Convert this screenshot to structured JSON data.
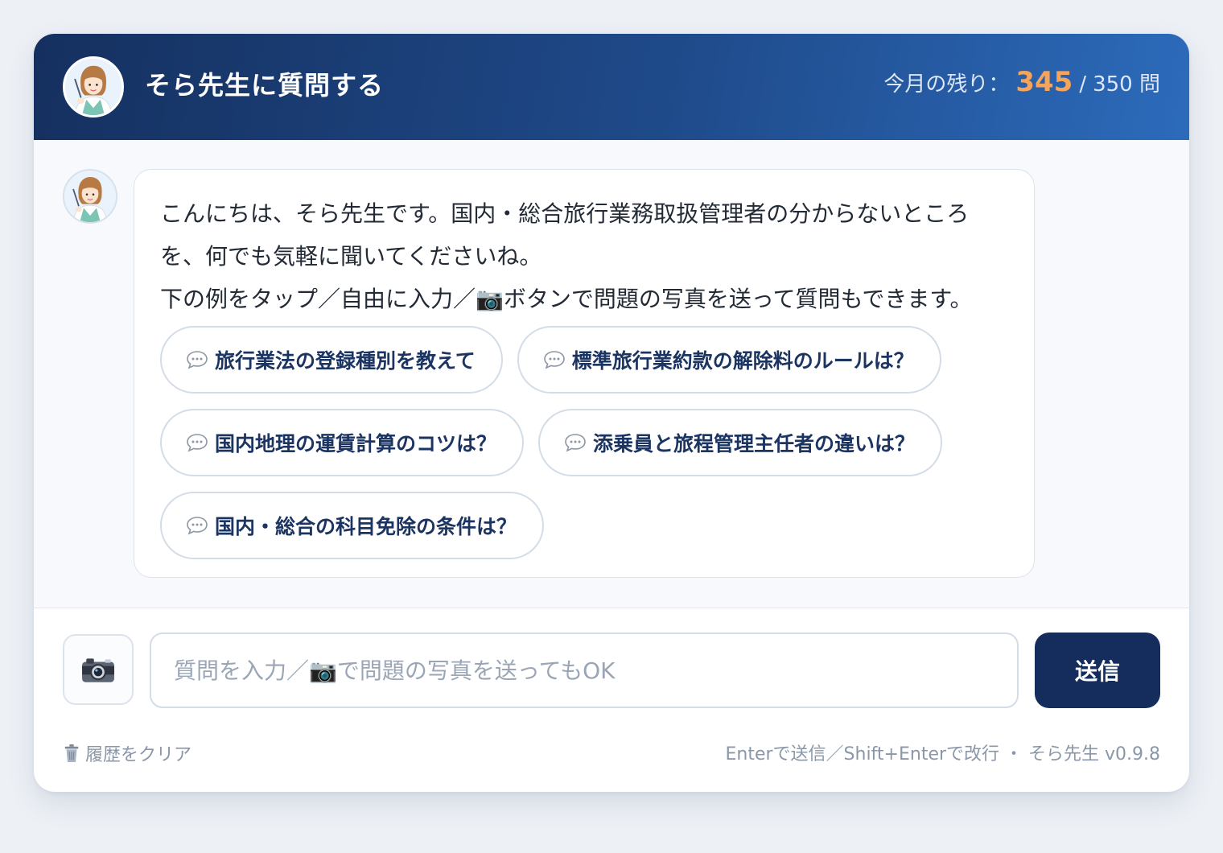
{
  "header": {
    "title": "そら先生に質問する",
    "quota_label": "今月の残り：",
    "quota_remaining": "345",
    "quota_separator": "/",
    "quota_total": "350 問"
  },
  "chat": {
    "greeting_lines": [
      "こんにちは、そら先生です。国内・総合旅行業務取扱管理者の分からないところ",
      "を、何でも気軽に聞いてくださいね。",
      "下の例をタップ／自由に入力／📷ボタンで問題の写真を送って質問もできます。"
    ],
    "suggestions": [
      "旅行業法の登録種別を教えて",
      "標準旅行業約款の解除料のルールは？",
      "国内地理の運賃計算のコツは？",
      "添乗員と旅程管理主任者の違いは？",
      "国内・総合の科目免除の条件は？"
    ]
  },
  "input": {
    "placeholder": "質問を入力／📷で問題の写真を送ってもOK",
    "value": "",
    "send_label": "送信"
  },
  "footer": {
    "clear_label": "履歴をクリア",
    "hint": "Enterで送信／Shift+Enterで改行 ・ そら先生 v0.9.8"
  },
  "icons": {
    "camera": "camera-icon",
    "chip": "speech-bubble-icon",
    "clear": "trash-icon",
    "avatar": "teacher-avatar-icon"
  },
  "colors": {
    "header_start": "#15305f",
    "header_end": "#2c6bbb",
    "accent": "#f5a45a",
    "send_button": "#142d5c",
    "chip_text": "#1b3461"
  }
}
